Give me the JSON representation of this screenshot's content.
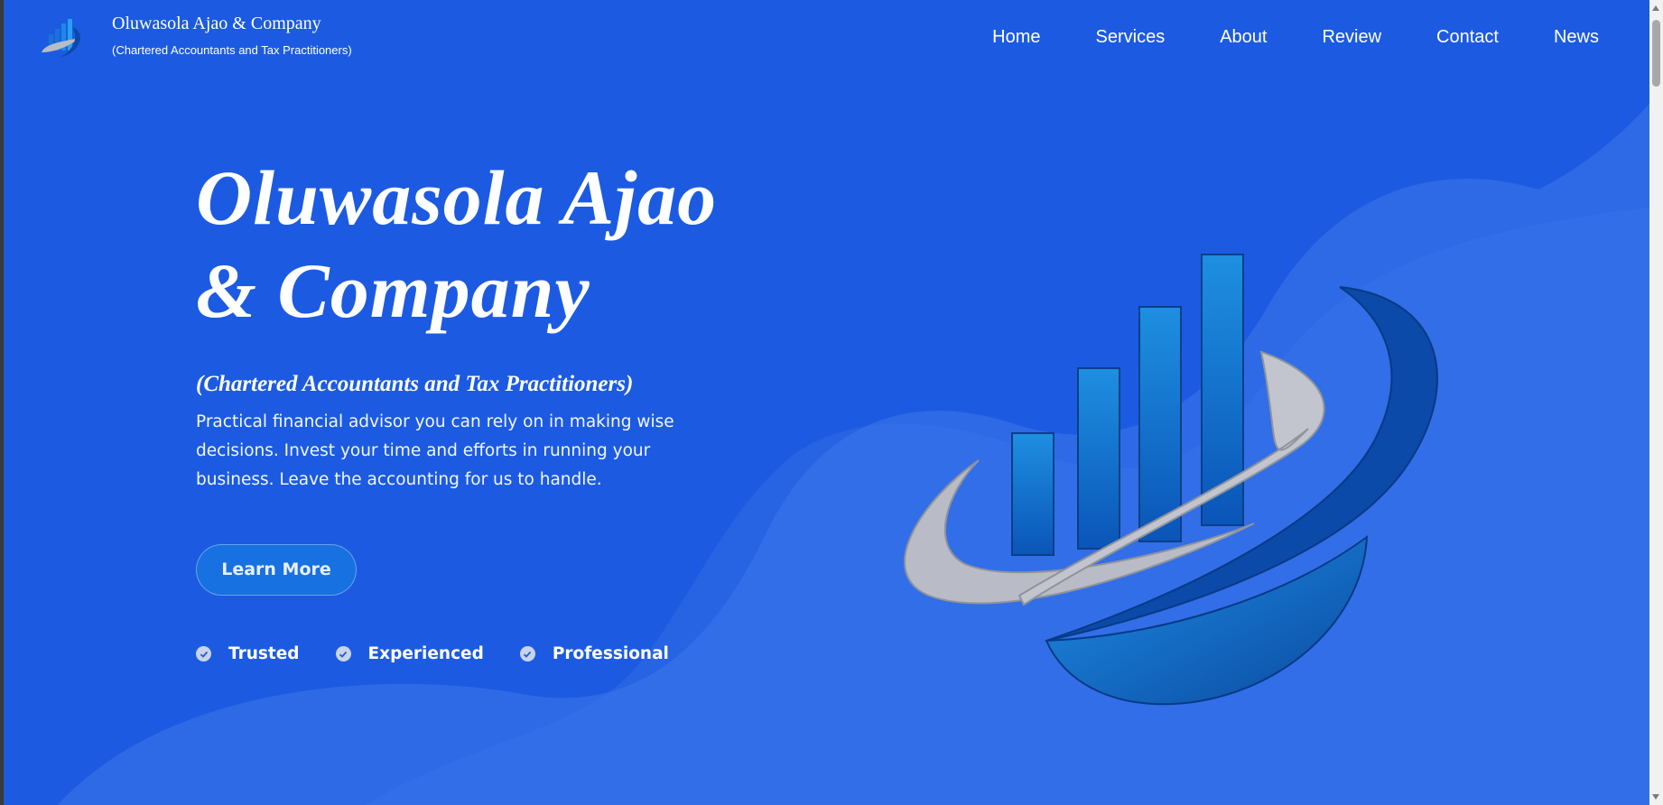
{
  "brand": {
    "title": "Oluwasola Ajao & Company",
    "subtitle": "(Chartered Accountants and Tax Practitioners)"
  },
  "nav": {
    "items": [
      "Home",
      "Services",
      "About",
      "Review",
      "Contact",
      "News"
    ]
  },
  "hero": {
    "title_line1": "Oluwasola Ajao",
    "title_line2": "& Company",
    "subtitle": "(Chartered Accountants and Tax Practitioners)",
    "description": "Practical financial advisor you can rely on in making wise decisions. Invest your time and efforts in running your business. Leave the accounting for us to handle.",
    "cta_label": "Learn More",
    "badges": [
      "Trusted",
      "Experienced",
      "Professional"
    ]
  },
  "colors": {
    "background": "#1c5be1",
    "wave": "#3a75e8",
    "button": "#1871e0",
    "logo_dark_blue": "#0b4aa8",
    "logo_silver": "#b9bcc6"
  },
  "icons": {
    "logo": "bar-chart-swoosh-logo",
    "badge": "check-circle-icon"
  }
}
